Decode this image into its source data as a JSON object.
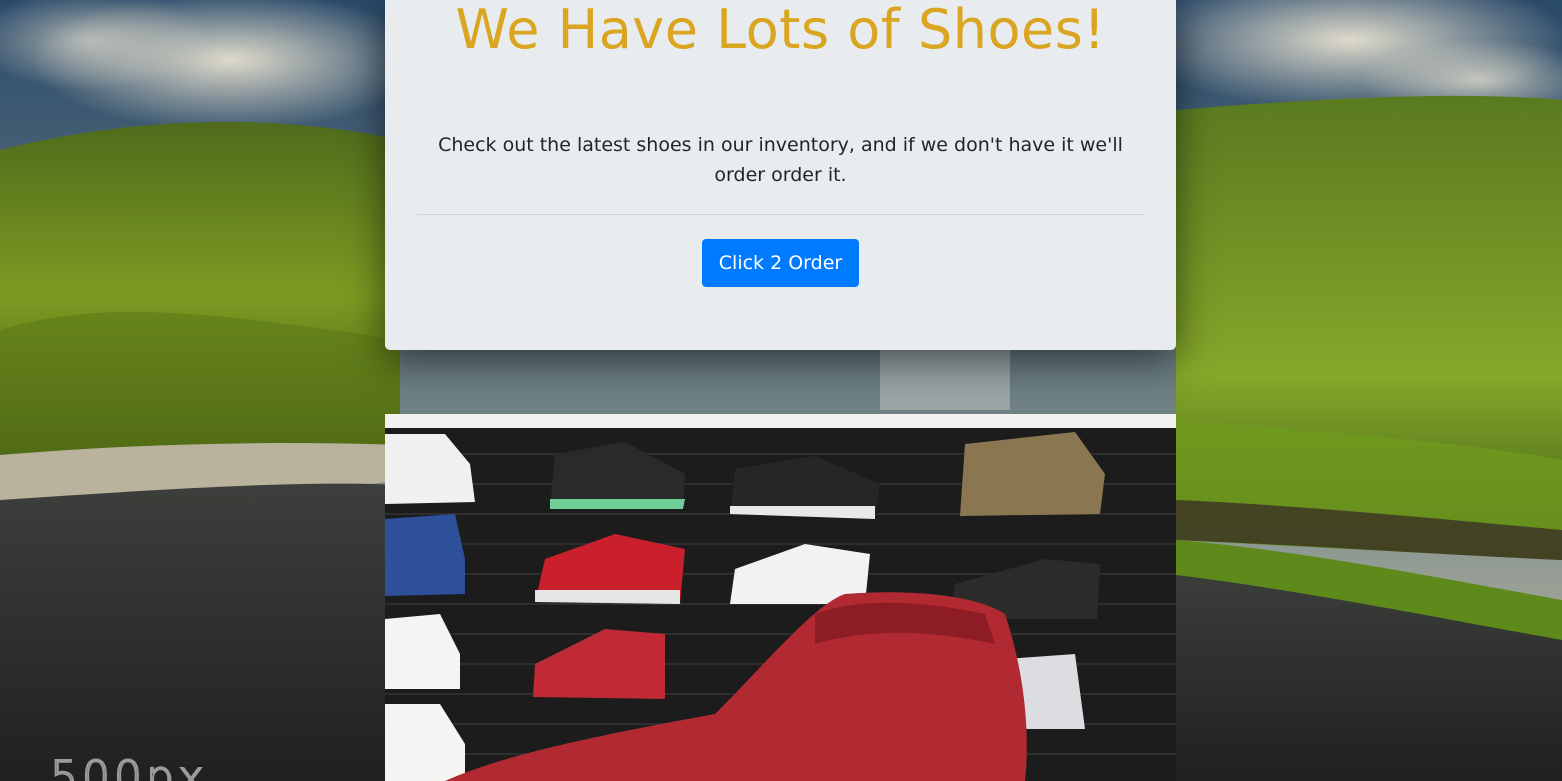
{
  "jumbotron": {
    "title": "We Have Lots of Shoes!",
    "lead": "Check out the latest shoes in our inventory, and if we don't have it we'll order order it.",
    "button_label": "Click 2 Order"
  },
  "watermark": {
    "text": "500px"
  },
  "colors": {
    "title": "#daa520",
    "button": "#007bff",
    "card_background": "#e9ecef"
  }
}
